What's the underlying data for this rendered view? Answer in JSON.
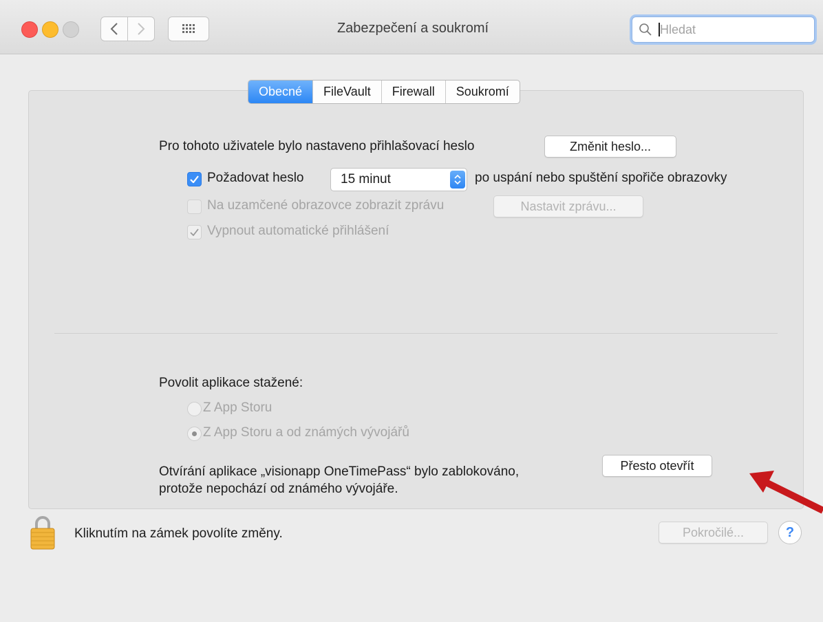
{
  "window": {
    "title": "Zabezpečení a soukromí",
    "search_placeholder": "Hledat"
  },
  "tabs": [
    {
      "label": "Obecné",
      "active": true
    },
    {
      "label": "FileVault",
      "active": false
    },
    {
      "label": "Firewall",
      "active": false
    },
    {
      "label": "Soukromí",
      "active": false
    }
  ],
  "general": {
    "password_set_text": "Pro tohoto uživatele bylo nastaveno přihlašovací heslo",
    "change_password_button": "Změnit heslo...",
    "require_password": {
      "checked": true,
      "label": "Požadovat heslo",
      "delay_value": "15 minut",
      "suffix": "po uspání nebo spuštění spořiče obrazovky"
    },
    "lock_message": {
      "checked": false,
      "enabled": false,
      "label": "Na uzamčené obrazovce zobrazit zprávu",
      "button": "Nastavit zprávu..."
    },
    "disable_autologin": {
      "checked": true,
      "enabled": false,
      "label": "Vypnout automatické přihlášení"
    }
  },
  "gatekeeper": {
    "heading": "Povolit aplikace stažené:",
    "options": [
      {
        "label": "Z App Storu",
        "selected": false
      },
      {
        "label": "Z App Storu a od známých vývojářů",
        "selected": true
      }
    ],
    "blocked_line1": "Otvírání aplikace „visionapp OneTimePass“ bylo zablokováno,",
    "blocked_line2": "protože nepochází od známého vývojáře.",
    "open_anyway_button": "Přesto otevřít"
  },
  "footer": {
    "lock_text": "Kliknutím na zámek povolíte změny.",
    "advanced_button": "Pokročilé...",
    "help_label": "?"
  },
  "colors": {
    "accent": "#2c87f5",
    "annotation_arrow": "#c8191c"
  }
}
